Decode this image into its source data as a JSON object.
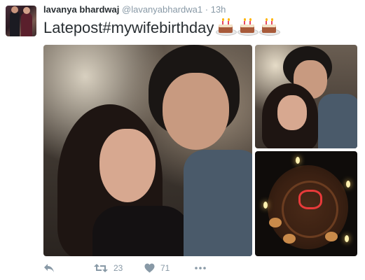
{
  "tweet": {
    "author_name": "lavanya bhardwaj",
    "author_handle": "@lavanyabhardwa1",
    "separator": "·",
    "time": "13h",
    "text": "Latepost#mywifebirthday",
    "emoji": [
      "birthday-cake-emoji",
      "birthday-cake-emoji",
      "birthday-cake-emoji"
    ]
  },
  "media": {
    "photos": [
      "selfie-couple",
      "selfie-couple-close",
      "birthday-cake"
    ]
  },
  "actions": {
    "reply_icon": "reply-icon",
    "retweet_icon": "retweet-icon",
    "retweet_count": "23",
    "like_icon": "heart-icon",
    "like_count": "71",
    "more_icon": "more-dots-icon"
  },
  "colors": {
    "text_primary": "#292f33",
    "text_secondary": "#8899a6",
    "background": "#ffffff"
  }
}
